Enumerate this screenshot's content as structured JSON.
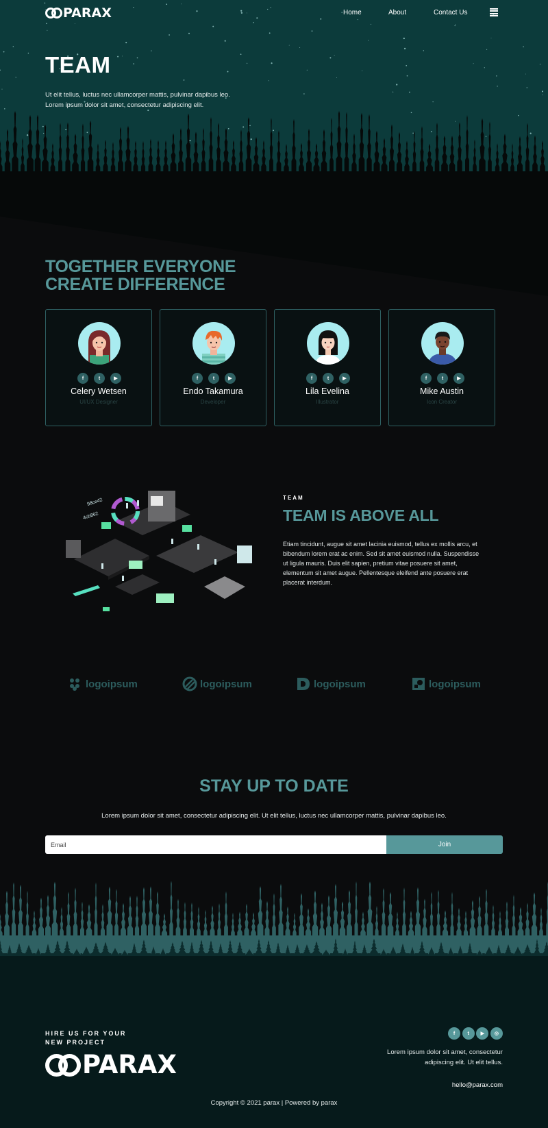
{
  "brand": {
    "name": "PARAX"
  },
  "nav": {
    "items": [
      "Home",
      "About",
      "Contact Us"
    ],
    "menu_icon": "hamburger-icon"
  },
  "hero": {
    "title": "TEAM",
    "text": "Ut elit tellus, luctus nec ullamcorper mattis, pulvinar dapibus leo. Lorem ipsum dolor sit amet, consectetur adipiscing elit."
  },
  "team": {
    "heading_line1": "TOGETHER EVERYONE",
    "heading_line2": "CREATE DIFFERENCE",
    "members": [
      {
        "name": "Celery Wetsen",
        "role": "UI/UX Designer"
      },
      {
        "name": "Endo Takamura",
        "role": "Developer"
      },
      {
        "name": "Lila Evelina",
        "role": "Illustrator"
      },
      {
        "name": "Mike Austin",
        "role": "Icon Creator"
      }
    ],
    "social_icons": [
      "facebook-icon",
      "twitter-icon",
      "youtube-icon"
    ]
  },
  "about": {
    "eyebrow": "TEAM",
    "title": "TEAM IS ABOVE ALL",
    "text": "Etiam tincidunt, augue sit amet lacinia euismod, tellus ex mollis arcu, et bibendum lorem erat ac enim. Sed sit amet euismod nulla. Suspendisse ut ligula mauris. Duis elit sapien, pretium vitae posuere sit amet, elementum sit amet augue. Pellentesque eleifend ante posuere erat placerat interdum.",
    "illustration_labels": [
      "98ce42",
      "4cb862"
    ]
  },
  "logos": [
    "logoipsum",
    "logoipsum",
    "logoipsum",
    "logoipsum"
  ],
  "newsletter": {
    "title": "STAY UP TO DATE",
    "text": "Lorem ipsum dolor sit amet, consectetur adipiscing elit. Ut elit tellus, luctus nec ullamcorper mattis, pulvinar dapibus leo.",
    "email_placeholder": "Email",
    "button": "Join"
  },
  "footer": {
    "hire_line1": "HIRE US FOR YOUR",
    "hire_line2": "NEW PROJECT",
    "address": "Lorem ipsum dolor sit amet, consectetur adipiscing elit. Ut elit tellus.",
    "email": "hello@parax.com",
    "copyright": "Copyright © 2021 parax | Powered by parax",
    "social_icons": [
      "facebook-icon",
      "twitter-icon",
      "youtube-icon",
      "dribbble-icon"
    ]
  },
  "colors": {
    "accent": "#57989a",
    "hero_bg": "#0c3b3b",
    "page_bg": "#0b0c0d",
    "footer_bg": "#061a1b"
  }
}
